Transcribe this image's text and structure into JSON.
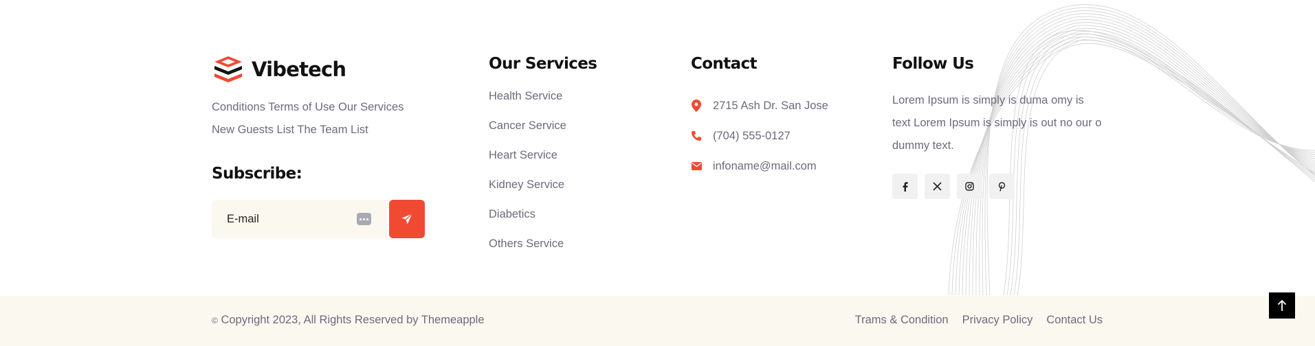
{
  "brand": {
    "name": "Vibetech",
    "links_line1": "Conditions Terms of Use Our Services",
    "links_line2": "New Guests List The Team List",
    "accent": "#f04a32"
  },
  "subscribe": {
    "title": "Subscribe:",
    "email_placeholder": "E-mail"
  },
  "services": {
    "title": "Our Services",
    "items": [
      "Health Service",
      "Cancer Service",
      "Heart Service",
      "Kidney Service",
      "Diabetics",
      "Others Service"
    ]
  },
  "contact": {
    "title": "Contact",
    "address": "2715 Ash Dr. San Jose",
    "phone": "(704) 555-0127",
    "email": "infoname@mail.com"
  },
  "follow": {
    "title": "Follow Us",
    "text_line1": "Lorem Ipsum is simply is duma omy is",
    "text_line2": "text Lorem Ipsum is simply is out no our o",
    "text_line3": "dummy text.",
    "social_icons": [
      "facebook-icon",
      "x-icon",
      "instagram-icon",
      "pinterest-icon"
    ]
  },
  "bottom": {
    "copyright_symbol": "©",
    "copyright": "Copyright 2023, All Rights Reserved by Themeapple",
    "links": [
      "Trams & Condition",
      "Privacy Policy",
      "Contact Us"
    ],
    "bg": "#fbf8f0"
  }
}
